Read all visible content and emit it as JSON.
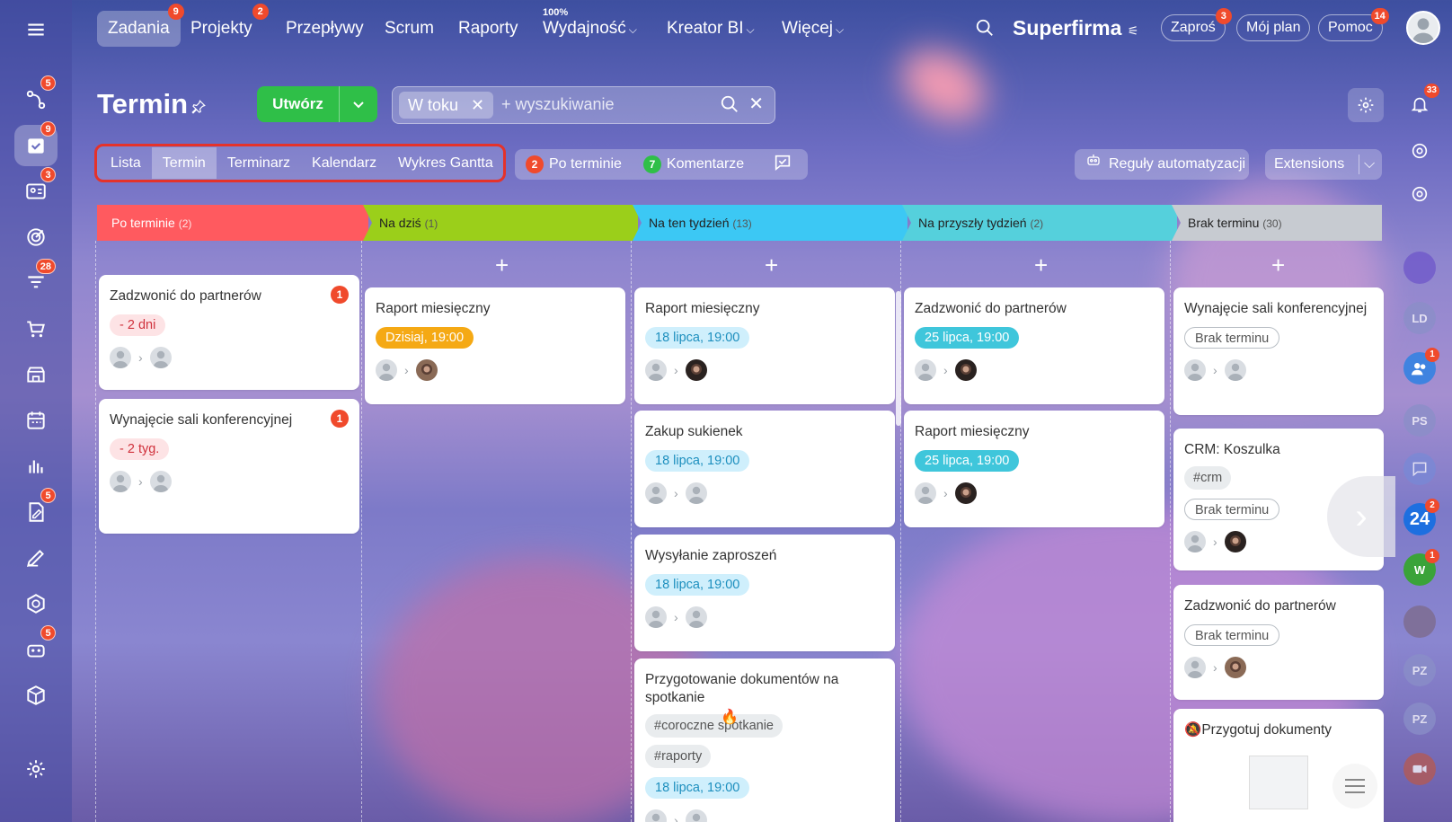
{
  "colors": {
    "overdue": "#ff5a5f",
    "today": "#9bcf1a",
    "week": "#3cc8f4",
    "next_week": "#55d0dc",
    "no_deadline": "#c7cbd1",
    "create_green": "#2fbf48",
    "badge_red": "#f04a2c"
  },
  "left_rail": [
    {
      "icon": "menu-icon"
    },
    {
      "icon": "flow-icon",
      "badge": "5"
    },
    {
      "icon": "tasks-icon",
      "badge": "9",
      "active": true
    },
    {
      "icon": "contact-card-icon",
      "badge": "3"
    },
    {
      "icon": "target-icon"
    },
    {
      "icon": "funnel-icon",
      "badge": "28"
    },
    {
      "icon": "cart-icon"
    },
    {
      "icon": "store-icon"
    },
    {
      "icon": "calendar-icon"
    },
    {
      "icon": "chart-icon"
    },
    {
      "icon": "document-sign-icon",
      "badge": "5"
    },
    {
      "icon": "pen-icon"
    },
    {
      "icon": "hexagon-icon"
    },
    {
      "icon": "robot-icon",
      "badge": "5"
    },
    {
      "icon": "box-icon"
    },
    {
      "icon": "settings-icon"
    }
  ],
  "topnav": {
    "items": [
      {
        "label": "Zadania",
        "badge": "9",
        "active": true
      },
      {
        "label": "Projekty",
        "badge": "2"
      },
      {
        "label": "Przepływy"
      },
      {
        "label": "Scrum"
      },
      {
        "label": "Raporty"
      },
      {
        "label": "Wydajność",
        "top_label": "100%",
        "dropdown": true
      },
      {
        "label": "Kreator BI",
        "dropdown": true
      },
      {
        "label": "Więcej",
        "dropdown": true
      }
    ],
    "brand": "Superfirma",
    "invite": {
      "label": "Zaproś",
      "badge": "3"
    },
    "my_plan": "Mój plan",
    "help": {
      "label": "Pomoc",
      "badge": "14"
    }
  },
  "page": {
    "title": "Termin",
    "create_label": "Utwórz",
    "filter_chip": "W toku",
    "search_placeholder": "+ wyszukiwanie"
  },
  "view_tabs": [
    "Lista",
    "Termin",
    "Terminarz",
    "Kalendarz",
    "Wykres Gantta"
  ],
  "active_view": "Termin",
  "counters": {
    "overdue": {
      "count": "2",
      "label": "Po terminie"
    },
    "comments": {
      "count": "7",
      "label": "Komentarze"
    }
  },
  "automation_label": "Reguły automatyzacji",
  "extensions_label": "Extensions",
  "columns": [
    {
      "title": "Po terminie",
      "count": "(2)",
      "cards": [
        {
          "title": "Zadzwonić do partnerów",
          "badge": "1",
          "deadline": "- 2 dni"
        },
        {
          "title": "Wynajęcie sali konferencyjnej",
          "badge": "1",
          "deadline": "- 2 tyg."
        }
      ]
    },
    {
      "title": "Na dziś",
      "count": "(1)",
      "cards": [
        {
          "title": "Raport miesięczny",
          "deadline": "Dzisiaj, 19:00"
        }
      ]
    },
    {
      "title": "Na ten tydzień",
      "count": "(13)",
      "cards": [
        {
          "title": "Raport miesięczny",
          "deadline": "18 lipca, 19:00"
        },
        {
          "title": "Zakup sukienek",
          "deadline": "18 lipca, 19:00"
        },
        {
          "title": "Wysyłanie zaproszeń",
          "deadline": "18 lipca, 19:00"
        },
        {
          "title": "Przygotowanie dokumentów na spotkanie",
          "tags": [
            "#coroczne spotkanie",
            "#raporty"
          ],
          "deadline": "18 lipca, 19:00"
        }
      ]
    },
    {
      "title": "Na przyszły tydzień",
      "count": "(2)",
      "cards": [
        {
          "title": "Zadzwonić do partnerów",
          "deadline": "25 lipca, 19:00"
        },
        {
          "title": "Raport miesięczny",
          "deadline": "25 lipca, 19:00"
        }
      ]
    },
    {
      "title": "Brak terminu",
      "count": "(30)",
      "cards": [
        {
          "title": "Wynajęcie sali konferencyjnej",
          "deadline": "Brak terminu"
        },
        {
          "title": "CRM: Koszulka",
          "tags": [
            "#crm"
          ],
          "deadline": "Brak terminu"
        },
        {
          "title": "Zadzwonić do partnerów",
          "deadline": "Brak terminu"
        },
        {
          "title": "Przygotuj dokumenty"
        }
      ]
    }
  ],
  "right_rail": [
    {
      "icon": "bell-icon",
      "badge": "33"
    },
    {
      "icon": "target-circle-icon"
    },
    {
      "icon": "search-chat-icon"
    },
    {
      "icon": "avatar-purple"
    },
    {
      "icon": "avatar-ld",
      "initials": "LD"
    },
    {
      "icon": "group-icon",
      "badge": "1"
    },
    {
      "icon": "avatar-ps",
      "initials": "PS"
    },
    {
      "icon": "chat-icon"
    },
    {
      "icon": "bitrix24-icon",
      "badge": "2",
      "initials": "24"
    },
    {
      "icon": "avatar-w",
      "badge": "1",
      "initials": "W"
    },
    {
      "icon": "avatar-photo"
    },
    {
      "icon": "avatar-pz",
      "initials": "PZ"
    },
    {
      "icon": "avatar-pz2",
      "initials": "PZ"
    },
    {
      "icon": "video-icon"
    }
  ]
}
